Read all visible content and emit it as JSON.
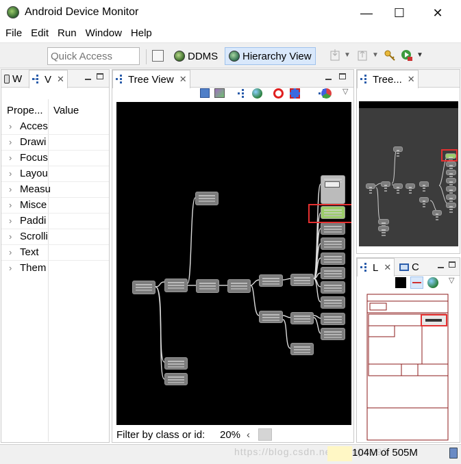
{
  "window": {
    "title": "Android Device Monitor",
    "controls": [
      "—",
      "☐",
      "✕"
    ]
  },
  "menubar": [
    "File",
    "Edit",
    "Run",
    "Window",
    "Help"
  ],
  "toolbar": {
    "quick_access_placeholder": "Quick Access",
    "perspectives": [
      {
        "label": "DDMS",
        "icon": "ddms-icon",
        "active": false
      },
      {
        "label": "Hierarchy View",
        "icon": "hierarchy-view-icon",
        "active": true
      }
    ]
  },
  "left_panel": {
    "tabs": [
      {
        "label": "W",
        "icon": "phone-icon"
      },
      {
        "label": "V",
        "icon": "view-properties-icon"
      }
    ],
    "columns": [
      "Prope...",
      "Value"
    ],
    "rows": [
      "Acces",
      "Drawi",
      "Focus",
      "Layou",
      "Measu",
      "Misce",
      "Paddi",
      "Scrolli",
      "Text",
      "Them"
    ]
  },
  "tree_view": {
    "tab_label": "Tree View",
    "filter_label": "Filter by class or id:",
    "zoom": "20%"
  },
  "tree_overview": {
    "tab_label": "Tree..."
  },
  "layout_panel": {
    "tabs": [
      {
        "label": "L",
        "icon": "layout-icon"
      },
      {
        "label": "C",
        "icon": "computer-icon"
      }
    ]
  },
  "status": {
    "memory": "104M of 505M",
    "watermark": "https://blog.csdn.net/qiaoji0193"
  },
  "colors": {
    "selection_highlight": "#e53030",
    "canvas_bg": "#000000",
    "node_fill": "#7c7c7c",
    "active_perspective": "#d9e8fb"
  }
}
